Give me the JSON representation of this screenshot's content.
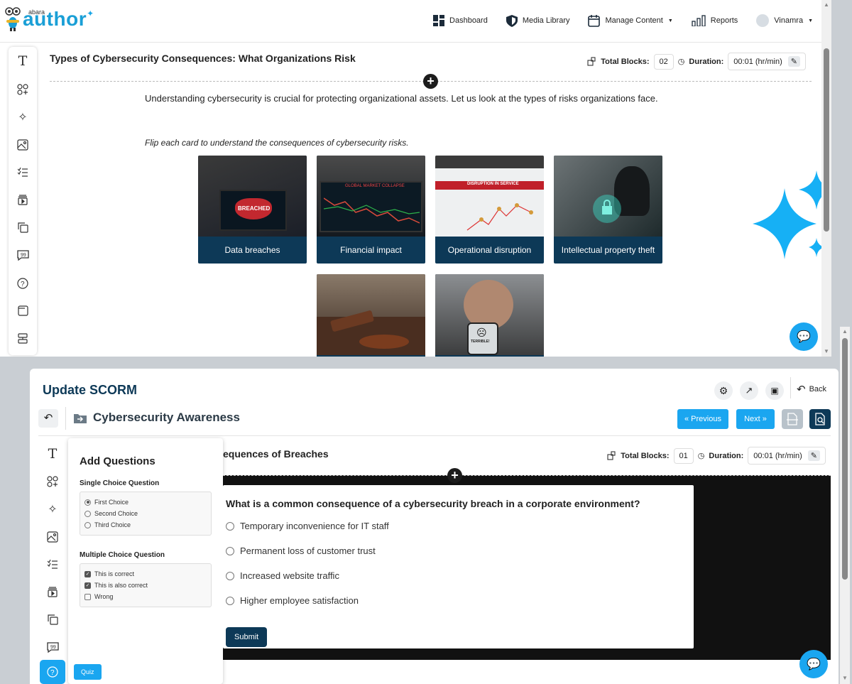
{
  "brand": {
    "small": "abara",
    "main": "author"
  },
  "nav": {
    "dashboard": "Dashboard",
    "media_library": "Media Library",
    "manage_content": "Manage Content",
    "reports": "Reports",
    "user": "Vinamra"
  },
  "top_editor": {
    "title": "Types of Cybersecurity Consequences: What Organizations Risk",
    "total_blocks_label": "Total Blocks:",
    "total_blocks_value": "02",
    "duration_label": "Duration:",
    "duration_value": "00:01 (hr/min)",
    "intro": "Understanding cybersecurity is crucial for protecting organizational assets. Let us look at the types of risks organizations face.",
    "instruction": "Flip each card to understand the consequences of cybersecurity risks.",
    "cards": [
      {
        "label": "Data breaches",
        "img_text": "BREACHED"
      },
      {
        "label": "Financial impact",
        "img_text": "GLOBAL MARKET COLLAPSE"
      },
      {
        "label": "Operational disruption",
        "img_text": "DISRUPTION IN SERVICE"
      },
      {
        "label": "Intellectual property theft",
        "img_text": ""
      },
      {
        "label": "",
        "img_text": ""
      },
      {
        "label": "",
        "img_text": "TERRIBLE!"
      }
    ]
  },
  "bottom_editor": {
    "heading": "Update SCORM",
    "back_label": "Back",
    "course_title": "Cybersecurity Awareness",
    "prev_label": "« Previous",
    "next_label": "Next »",
    "block_title": "equences of Breaches",
    "total_blocks_label": "Total Blocks:",
    "total_blocks_value": "01",
    "duration_label": "Duration:",
    "duration_value": "00:01 (hr/min)",
    "panel": {
      "title": "Add Questions",
      "single_label": "Single Choice Question",
      "single_options": [
        "First Choice",
        "Second Choice",
        "Third Choice"
      ],
      "multi_label": "Multiple Choice Question",
      "multi_options": [
        "This is correct",
        "This is also correct",
        "Wrong"
      ]
    },
    "question": {
      "text": "What is a common consequence of a cybersecurity breach in a corporate environment?",
      "options": [
        "Temporary inconvenience for IT staff",
        "Permanent loss of customer trust",
        "Increased website traffic",
        "Higher employee satisfaction"
      ],
      "submit_label": "Submit"
    },
    "quiz_tooltip": "Quiz"
  },
  "colors": {
    "brand_blue": "#1aa6f0",
    "navy": "#0d3957"
  }
}
